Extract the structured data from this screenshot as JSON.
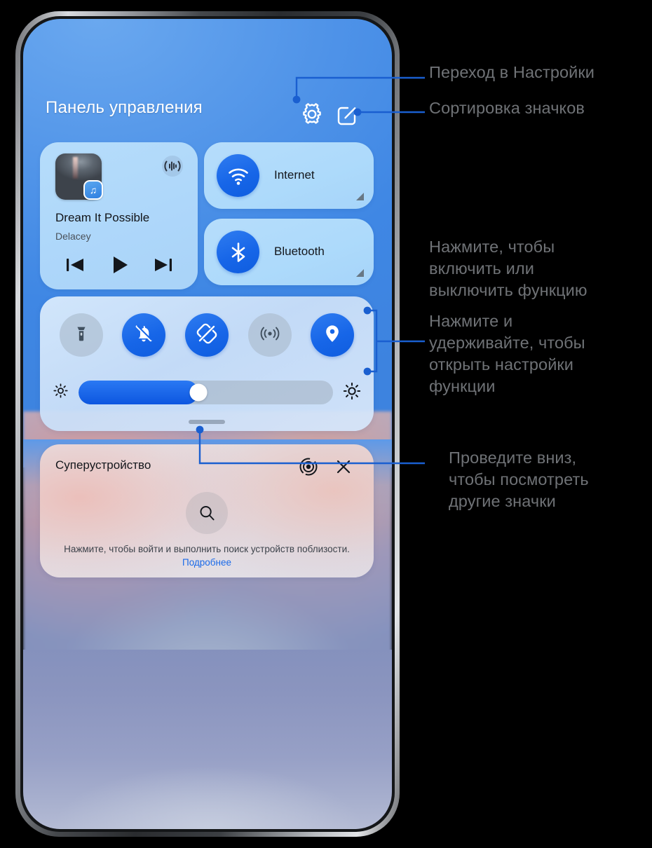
{
  "colors": {
    "accent_blue": "#1766e8",
    "callout_line": "#1a5fd0",
    "annotation_text": "#6f7276",
    "wallpaper_top": "#4f93e8",
    "card_blue": "#b6ddfb",
    "link_blue": "#1a6ae8"
  },
  "control_panel": {
    "title": "Панель управления",
    "settings_icon": "gear-icon",
    "sort_icon": "edit-square-icon"
  },
  "media": {
    "track_title": "Dream It Possible",
    "artist": "Delacey",
    "cast_icon": "audio-cast-icon",
    "album_badge_icon": "music-note-icon",
    "controls": [
      {
        "name": "previous-track",
        "icon": "skip-previous-icon"
      },
      {
        "name": "play",
        "icon": "play-icon"
      },
      {
        "name": "next-track",
        "icon": "skip-next-icon"
      }
    ]
  },
  "connectivity": [
    {
      "label": "Internet",
      "icon": "wifi-icon",
      "state": "on",
      "expand": "expand-corner-icon"
    },
    {
      "label": "Bluetooth",
      "icon": "bluetooth-icon",
      "state": "on",
      "expand": "expand-corner-icon"
    }
  ],
  "toggles": [
    {
      "name": "flashlight",
      "icon": "flashlight-icon",
      "state": "off"
    },
    {
      "name": "silent-mode",
      "icon": "bell-slash-icon",
      "state": "on"
    },
    {
      "name": "auto-rotate",
      "icon": "screen-rotate-icon",
      "state": "on"
    },
    {
      "name": "hotspot",
      "icon": "hotspot-icon",
      "state": "off"
    },
    {
      "name": "location",
      "icon": "location-pin-icon",
      "state": "on"
    }
  ],
  "brightness": {
    "value_percent": 47,
    "low_icon": "brightness-low-icon",
    "high_icon": "brightness-high-icon",
    "handle": "drag-handle"
  },
  "super_device": {
    "title": "Суперустройство",
    "target_icon": "radar-target-icon",
    "close_icon": "close-icon",
    "search_icon": "search-icon",
    "hint_text": "Нажмите, чтобы войти и выполнить поиск устройств поблизости. ",
    "hint_link": "Подробнее"
  },
  "annotations": {
    "settings": "Переход в Настройки",
    "sort": "Сортировка значков",
    "toggle": "Нажмите, чтобы\nвключить или\nвыключить функцию",
    "longpress": "Нажмите и\nудерживайте, чтобы\nоткрыть настройки\nфункции",
    "swipe": "Проведите вниз,\nчтобы посмотреть\nдругие значки"
  }
}
